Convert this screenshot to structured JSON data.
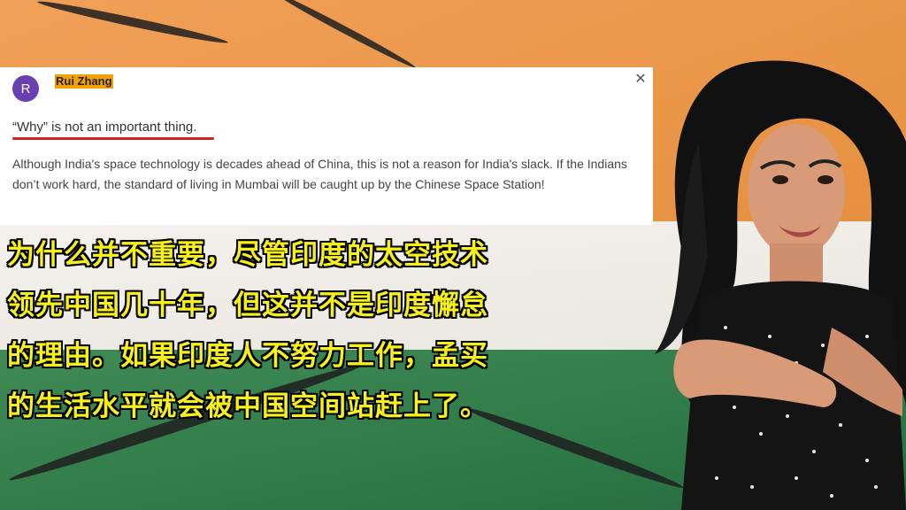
{
  "comment": {
    "avatar_letter": "R",
    "author": "Rui Zhang",
    "close_icon": "close-icon",
    "headline": "“Why” is not an important thing.",
    "body": "Although India's space technology is decades ahead of China, this is not a reason for India's slack. If the Indians don’t work hard, the standard of living in Mumbai will be caught up by the Chinese Space Station!"
  },
  "subtitles": [
    "为什么并不重要，尽管印度的太空技术",
    "领先中国几十年，但这并不是印度懈怠",
    "的理由。如果印度人不努力工作，孟买",
    "的生活水平就会被中国空间站赶上了。"
  ],
  "colors": {
    "avatar": "#6b3fb0",
    "highlight": "#f2a100",
    "underline": "#d62020",
    "subtitle": "#f7f019",
    "saffron": "#ec9a4f",
    "green": "#2f7a48"
  }
}
